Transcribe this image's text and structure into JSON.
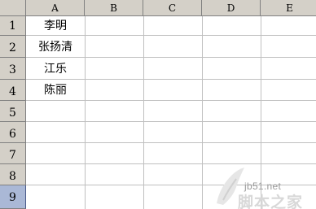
{
  "columns": [
    "A",
    "B",
    "C",
    "D",
    "E"
  ],
  "rows": [
    "1",
    "2",
    "3",
    "4",
    "5",
    "6",
    "7",
    "8",
    "9"
  ],
  "active_row": "9",
  "cells": {
    "A1": "李明",
    "A2": "张扬清",
    "A3": "江乐",
    "A4": "陈丽"
  },
  "watermark": {
    "host": "jb51.net",
    "name": "脚本之家"
  },
  "colors": {
    "header_bg": "#d4d0c8",
    "active_row_header": "#aab8d6",
    "gridline": "#c0c0c0"
  }
}
